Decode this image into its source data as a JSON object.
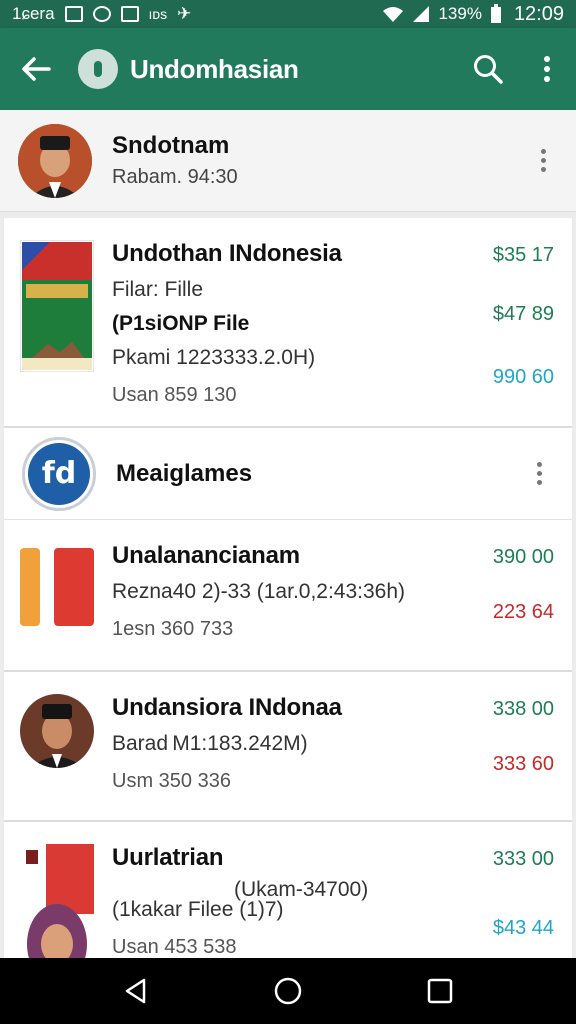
{
  "status_bar": {
    "carrier": "1ɕera",
    "misc": "ıᴅs",
    "battery": "139%",
    "time": "12:09"
  },
  "app_bar": {
    "title": "Undomhasian"
  },
  "header": {
    "title": "Sndotnam",
    "subtitle": "Rabam. 94:30"
  },
  "cards": [
    {
      "title": "Undothan INdonesia",
      "line1": "Filar: Fille",
      "line2": "(P1siONP File",
      "line3": "Pkami 1223333.2.0H)",
      "meta": "Usan 859 130",
      "amounts": [
        "$35 17",
        "$47 89",
        "990 60"
      ]
    }
  ],
  "section": {
    "title": "Meaiglames"
  },
  "section_items": [
    {
      "title": "Unalanancianam",
      "line1": "Rezna40 2)-33 (1ar.0,2:43:36h)",
      "meta": "1esn 360 733",
      "amounts": [
        "390 00",
        "223 64"
      ]
    },
    {
      "title": "Undansiora INdonaa",
      "line1": "Barad M1:183.242M)",
      "meta": "Usm 350 336",
      "amounts": [
        "338 00",
        "333 60"
      ]
    },
    {
      "title": "Uurlatrian",
      "line0": "(Ukam-34700)",
      "line1": "(1kakar Filee (1)7)",
      "meta": "Usan 453 538",
      "amounts": [
        "333 00",
        "$43 44"
      ]
    }
  ]
}
